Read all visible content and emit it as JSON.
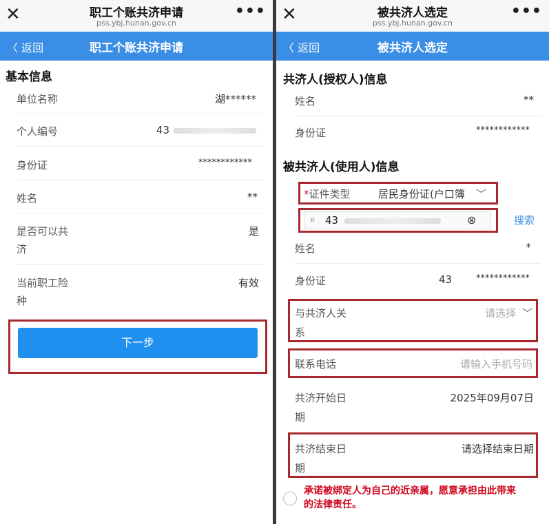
{
  "left": {
    "chrome": {
      "title": "职工个账共济申请",
      "url": "pss.ybj.hunan.gov.cn"
    },
    "navbar": {
      "back": "〈 返回",
      "title": "职工个账共济申请"
    },
    "section": "基本信息",
    "rows": [
      {
        "label": "单位名称",
        "value": "湖******"
      },
      {
        "label": "个人编号",
        "value": "43"
      },
      {
        "label": "身份证",
        "value": "************"
      },
      {
        "label": "姓名",
        "value": "**"
      },
      {
        "label_line1": "是否可以共",
        "label_line2": "济",
        "value": "是"
      },
      {
        "label_line1": "当前职工险",
        "label_line2": "种",
        "value": "有效"
      }
    ],
    "next_button": "下一步"
  },
  "right": {
    "chrome": {
      "title": "被共济人选定",
      "url": "pss.ybj.hunan.gov.cn"
    },
    "navbar": {
      "back": "〈 返回",
      "title": "被共济人选定"
    },
    "section1": "共济人(授权人)信息",
    "grantor": [
      {
        "label": "姓名",
        "value": "**"
      },
      {
        "label": "身份证",
        "value": "************"
      }
    ],
    "section2": "被共济人(使用人)信息",
    "id_type": {
      "asterisk": "*",
      "label": "证件类型",
      "value": "居民身份证(户口簿"
    },
    "search": {
      "value": "43",
      "button": "搜索"
    },
    "beneficiary": [
      {
        "label": "姓名",
        "value": "*"
      },
      {
        "label": "身份证",
        "prefix": "43",
        "value": "************"
      }
    ],
    "relation": {
      "label_line1": "与共济人关",
      "label_line2": "系",
      "placeholder": "请选择"
    },
    "phone": {
      "label": "联系电话",
      "placeholder": "请输入手机号码"
    },
    "start_date": {
      "label_line1": "共济开始日",
      "label_line2": "期",
      "value": "2025年09月07日"
    },
    "end_date": {
      "label_line1": "共济结束日",
      "label_line2": "期",
      "placeholder": "请选择结束日期"
    },
    "pledge": {
      "line1": "承诺被绑定人为自己的近亲属，愿意承担由此带来",
      "line2": "的法律责任。"
    }
  },
  "colors": {
    "accent": "#3a8ee6",
    "button": "#1f8ff0",
    "highlight": "#a8282e",
    "warning": "#d0021b"
  }
}
